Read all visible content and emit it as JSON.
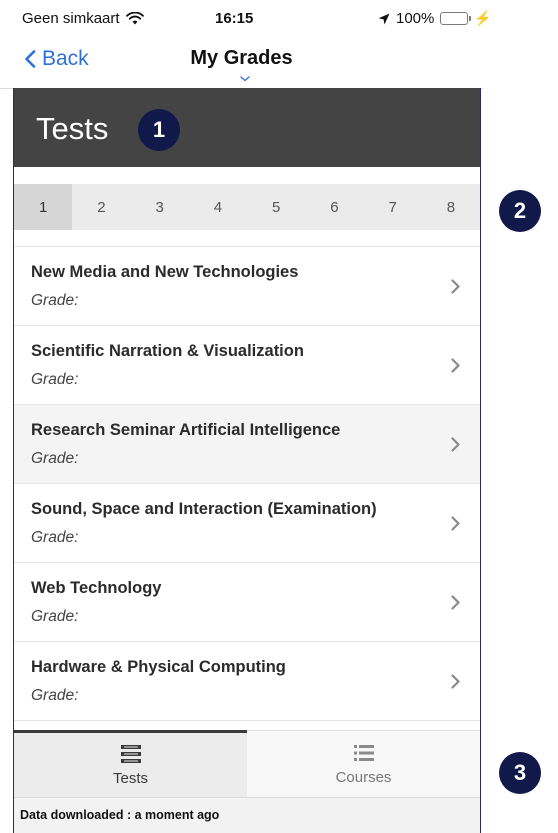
{
  "status_bar": {
    "carrier": "Geen simkaart",
    "time": "16:15",
    "battery": "100%",
    "battery_level": 1.0
  },
  "nav": {
    "back_label": "Back",
    "title": "My Grades"
  },
  "header": {
    "title": "Tests"
  },
  "badges": {
    "one": "1",
    "two": "2",
    "three": "3"
  },
  "page_tabs": {
    "items": [
      "1",
      "2",
      "3",
      "4",
      "5",
      "6",
      "7",
      "8"
    ],
    "active": "1"
  },
  "courses": {
    "grade_label": "Grade:",
    "items": [
      {
        "name": "New Media and New Technologies"
      },
      {
        "name": "Scientific Narration & Visualization"
      },
      {
        "name": "Research Seminar Artificial Intelligence"
      },
      {
        "name": "Sound, Space and Interaction (Examination)"
      },
      {
        "name": "Web Technology"
      },
      {
        "name": "Hardware & Physical Computing"
      }
    ]
  },
  "tabbar": {
    "tests_label": "Tests",
    "courses_label": "Courses"
  },
  "footer": {
    "download_text": "Data downloaded : a moment ago"
  },
  "colors": {
    "accent": "#2f6fd8",
    "header_bg": "#444444",
    "badge_bg": "#11194a",
    "battery": "#4cd964"
  }
}
